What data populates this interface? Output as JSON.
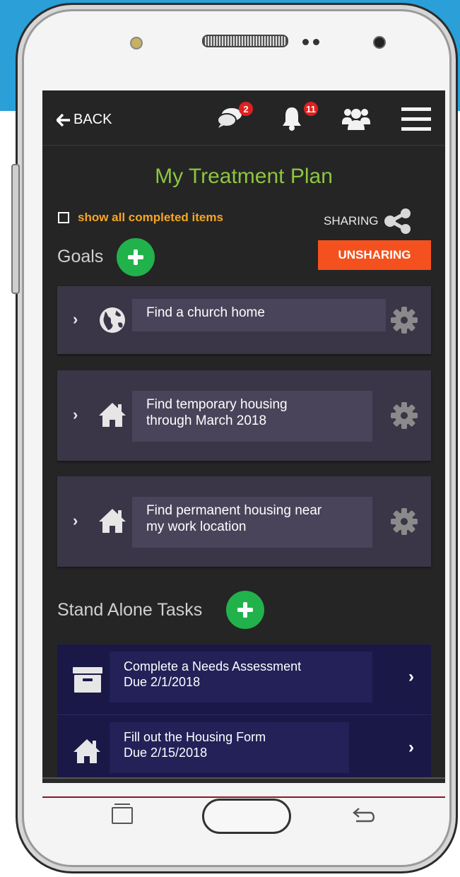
{
  "topbar": {
    "back_label": "BACK",
    "messages_badge": "2",
    "notifications_badge": "11"
  },
  "page": {
    "title": "My Treatment Plan",
    "show_completed_label": "show all completed items",
    "sharing_label": "SHARING",
    "unsharing_label": "UNSHARING"
  },
  "goals": {
    "heading": "Goals",
    "items": [
      {
        "icon": "globe-icon",
        "line1": "Find a church home",
        "line2": ""
      },
      {
        "icon": "home-icon",
        "line1": "Find temporary housing",
        "line2": "through March 2018"
      },
      {
        "icon": "home-icon",
        "line1": "Find permanent housing near",
        "line2": "my work location"
      }
    ]
  },
  "tasks": {
    "heading": "Stand Alone Tasks",
    "items": [
      {
        "icon": "archive-icon",
        "title": "Complete a Needs Assessment",
        "due": "Due 2/1/2018"
      },
      {
        "icon": "home-icon",
        "title": "Fill out the Housing Form",
        "due": "Due 2/15/2018"
      }
    ]
  },
  "colors": {
    "accent_green": "#8cc63f",
    "add_green": "#22b24c",
    "orange": "#f5a623",
    "unsharing": "#f5511e",
    "badge_red": "#e02020",
    "goal_card": "#3a3547",
    "task_list": "#1a1846"
  }
}
